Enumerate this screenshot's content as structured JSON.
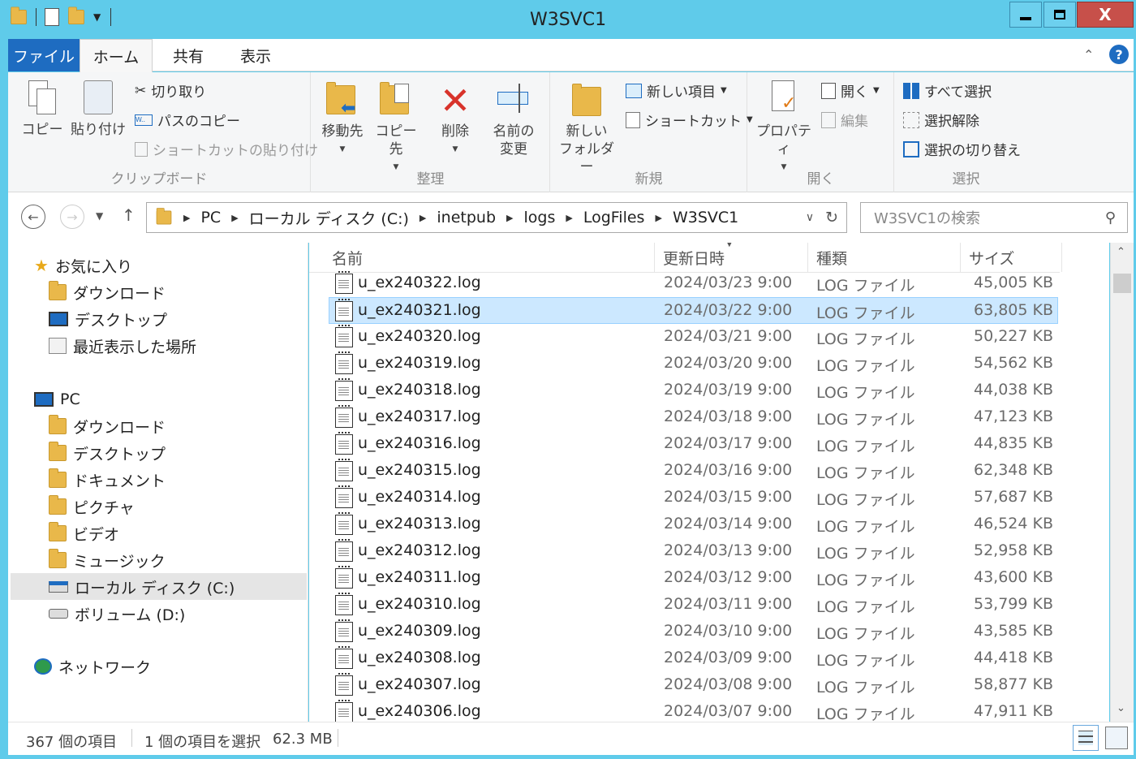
{
  "window": {
    "title": "W3SVC1",
    "minimize": "▁",
    "maximize": "▢",
    "close": "X"
  },
  "ribbon_tabs": {
    "file": "ファイル",
    "home": "ホーム",
    "share": "共有",
    "view": "表示"
  },
  "ribbon": {
    "clipboard": {
      "label": "クリップボード",
      "copy": "コピー",
      "paste": "貼り付け",
      "cut": "切り取り",
      "copy_path": "パスのコピー",
      "paste_shortcut": "ショートカットの貼り付け"
    },
    "organize": {
      "label": "整理",
      "move_to": "移動先",
      "copy_to": "コピー先",
      "delete": "削除",
      "rename_1": "名前の",
      "rename_2": "変更"
    },
    "new": {
      "label": "新規",
      "new_folder_1": "新しい",
      "new_folder_2": "フォルダー",
      "new_item": "新しい項目",
      "shortcut": "ショートカット"
    },
    "open": {
      "label": "開く",
      "properties": "プロパティ",
      "open": "開く",
      "edit": "編集"
    },
    "select": {
      "label": "選択",
      "select_all": "すべて選択",
      "select_none": "選択解除",
      "invert": "選択の切り替え"
    }
  },
  "address": {
    "crumbs": [
      "PC",
      "ローカル ディスク (C:)",
      "inetpub",
      "logs",
      "LogFiles",
      "W3SVC1"
    ]
  },
  "search": {
    "placeholder": "W3SVC1の検索"
  },
  "nav": {
    "favorites": "お気に入り",
    "fav_items": [
      "ダウンロード",
      "デスクトップ",
      "最近表示した場所"
    ],
    "pc": "PC",
    "pc_items": [
      "ダウンロード",
      "デスクトップ",
      "ドキュメント",
      "ピクチャ",
      "ビデオ",
      "ミュージック",
      "ローカル ディスク (C:)",
      "ボリューム (D:)"
    ],
    "network": "ネットワーク"
  },
  "columns": {
    "name": "名前",
    "date": "更新日時",
    "type": "種類",
    "size": "サイズ"
  },
  "files": [
    {
      "name": "u_ex240322.log",
      "date": "2024/03/23 9:00",
      "type": "LOG ファイル",
      "size": "45,005 KB"
    },
    {
      "name": "u_ex240321.log",
      "date": "2024/03/22 9:00",
      "type": "LOG ファイル",
      "size": "63,805 KB"
    },
    {
      "name": "u_ex240320.log",
      "date": "2024/03/21 9:00",
      "type": "LOG ファイル",
      "size": "50,227 KB"
    },
    {
      "name": "u_ex240319.log",
      "date": "2024/03/20 9:00",
      "type": "LOG ファイル",
      "size": "54,562 KB"
    },
    {
      "name": "u_ex240318.log",
      "date": "2024/03/19 9:00",
      "type": "LOG ファイル",
      "size": "44,038 KB"
    },
    {
      "name": "u_ex240317.log",
      "date": "2024/03/18 9:00",
      "type": "LOG ファイル",
      "size": "47,123 KB"
    },
    {
      "name": "u_ex240316.log",
      "date": "2024/03/17 9:00",
      "type": "LOG ファイル",
      "size": "44,835 KB"
    },
    {
      "name": "u_ex240315.log",
      "date": "2024/03/16 9:00",
      "type": "LOG ファイル",
      "size": "62,348 KB"
    },
    {
      "name": "u_ex240314.log",
      "date": "2024/03/15 9:00",
      "type": "LOG ファイル",
      "size": "57,687 KB"
    },
    {
      "name": "u_ex240313.log",
      "date": "2024/03/14 9:00",
      "type": "LOG ファイル",
      "size": "46,524 KB"
    },
    {
      "name": "u_ex240312.log",
      "date": "2024/03/13 9:00",
      "type": "LOG ファイル",
      "size": "52,958 KB"
    },
    {
      "name": "u_ex240311.log",
      "date": "2024/03/12 9:00",
      "type": "LOG ファイル",
      "size": "43,600 KB"
    },
    {
      "name": "u_ex240310.log",
      "date": "2024/03/11 9:00",
      "type": "LOG ファイル",
      "size": "53,799 KB"
    },
    {
      "name": "u_ex240309.log",
      "date": "2024/03/10 9:00",
      "type": "LOG ファイル",
      "size": "43,585 KB"
    },
    {
      "name": "u_ex240308.log",
      "date": "2024/03/09 9:00",
      "type": "LOG ファイル",
      "size": "44,418 KB"
    },
    {
      "name": "u_ex240307.log",
      "date": "2024/03/08 9:00",
      "type": "LOG ファイル",
      "size": "58,877 KB"
    },
    {
      "name": "u_ex240306.log",
      "date": "2024/03/07 9:00",
      "type": "LOG ファイル",
      "size": "47,911 KB"
    }
  ],
  "selected_file": "u_ex240321.log",
  "status": {
    "count": "367 個の項目",
    "selection": "1 個の項目を選択",
    "sel_size": "62.3 MB"
  },
  "colors": {
    "titlebar": "#5fcbea",
    "file_tab": "#1e6cc1",
    "selection": "#cce8ff",
    "close": "#c7504a"
  }
}
